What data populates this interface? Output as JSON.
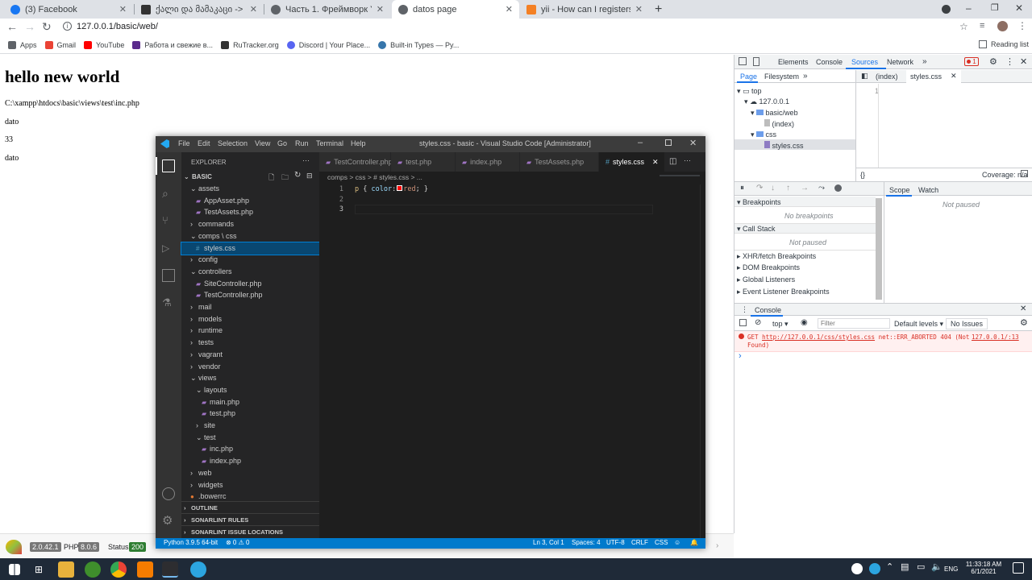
{
  "browser": {
    "tabs": [
      {
        "label": "(3) Facebook",
        "icon_color": "#1877f2",
        "active": false
      },
      {
        "label": "ქალი და მამაკაცი -> თბილი",
        "icon_color": "#333333",
        "active": false
      },
      {
        "label": "Часть 1. Фреймворк Yii2. Теори",
        "icon_color": "#5f6368",
        "active": false
      },
      {
        "label": "datos page",
        "icon_color": "#5f6368",
        "active": true
      },
      {
        "label": "yii - How can I registers jQuery a",
        "icon_color": "#f48024",
        "active": false
      }
    ],
    "new_tab": "+",
    "window_controls": {
      "minimize": "–",
      "restore": "❐",
      "close": "✕"
    },
    "url": "127.0.0.1/basic/web/",
    "bookmarks": [
      {
        "label": "Apps",
        "icon": "apps-grid-icon",
        "color": "#5f6368"
      },
      {
        "label": "Gmail",
        "icon": "gmail-icon",
        "color": "#ea4335"
      },
      {
        "label": "YouTube",
        "icon": "youtube-icon",
        "color": "#ff0000"
      },
      {
        "label": "Работа и свежие в...",
        "icon": "hh-icon",
        "color": "#5b2b8c"
      },
      {
        "label": "RuTracker.org",
        "icon": "rutracker-icon",
        "color": "#333333"
      },
      {
        "label": "Discord | Your Place...",
        "icon": "discord-icon",
        "color": "#5865f2"
      },
      {
        "label": "Built-in Types — Py...",
        "icon": "python-icon",
        "color": "#3776ab"
      }
    ],
    "reading_list": "Reading list"
  },
  "page": {
    "heading": "hello new world",
    "path": "C:\\xampp\\htdocs\\basic\\views\\test\\inc.php",
    "line1": "dato",
    "line2": "33",
    "line3": "dato"
  },
  "devtools": {
    "tabs": [
      "Elements",
      "Console",
      "Sources",
      "Network"
    ],
    "more": "»",
    "error_count": "1",
    "sources_nav": {
      "page": "Page",
      "filesystem": "Filesystem",
      "more": "»"
    },
    "tree": {
      "top": "top",
      "host": "127.0.0.1",
      "folder1": "basic/web",
      "index": "(index)",
      "folder2": "css",
      "file": "styles.css"
    },
    "editor_tabs": {
      "index": "(index)",
      "styles": "styles.css"
    },
    "line_number": "1",
    "coverage": "Coverage: n/a",
    "braces": "{}",
    "scope_tabs": {
      "scope": "Scope",
      "watch": "Watch"
    },
    "not_paused": "Not paused",
    "sections": {
      "breakpoints": "Breakpoints",
      "no_breakpoints": "No breakpoints",
      "call_stack": "Call Stack",
      "call_not_paused": "Not paused",
      "xhr": "XHR/fetch Breakpoints",
      "dom": "DOM Breakpoints",
      "global": "Global Listeners",
      "event": "Event Listener Breakpoints"
    },
    "console": {
      "title": "Console",
      "context": "top ▾",
      "filter_placeholder": "Filter",
      "levels": "Default levels ▾",
      "issues": "No Issues",
      "error_method": "GET",
      "error_url": "http://127.0.0.1/css/styles.css",
      "error_text": "net::ERR_ABORTED 404 (Not",
      "error_text2": "Found)",
      "error_source": "127.0.0.1/:13",
      "prompt": "›"
    }
  },
  "vscode": {
    "menu": [
      "File",
      "Edit",
      "Selection",
      "View",
      "Go",
      "Run",
      "Terminal",
      "Help"
    ],
    "title": "styles.css - basic - Visual Studio Code [Administrator]",
    "explorer": "EXPLORER",
    "explorer_more": "···",
    "root": "BASIC",
    "tree": [
      {
        "label": "assets",
        "depth": 1,
        "kind": "open"
      },
      {
        "label": "AppAsset.php",
        "depth": 2,
        "kind": "php"
      },
      {
        "label": "TestAssets.php",
        "depth": 2,
        "kind": "php"
      },
      {
        "label": "commands",
        "depth": 1,
        "kind": "closed"
      },
      {
        "label": "comps \\ css",
        "depth": 1,
        "kind": "open"
      },
      {
        "label": "styles.css",
        "depth": 2,
        "kind": "css",
        "selected": true
      },
      {
        "label": "config",
        "depth": 1,
        "kind": "closed"
      },
      {
        "label": "controllers",
        "depth": 1,
        "kind": "open"
      },
      {
        "label": "SiteController.php",
        "depth": 2,
        "kind": "php"
      },
      {
        "label": "TestController.php",
        "depth": 2,
        "kind": "php"
      },
      {
        "label": "mail",
        "depth": 1,
        "kind": "closed"
      },
      {
        "label": "models",
        "depth": 1,
        "kind": "closed"
      },
      {
        "label": "runtime",
        "depth": 1,
        "kind": "closed"
      },
      {
        "label": "tests",
        "depth": 1,
        "kind": "closed"
      },
      {
        "label": "vagrant",
        "depth": 1,
        "kind": "closed"
      },
      {
        "label": "vendor",
        "depth": 1,
        "kind": "closed"
      },
      {
        "label": "views",
        "depth": 1,
        "kind": "open"
      },
      {
        "label": "layouts",
        "depth": 2,
        "kind": "open"
      },
      {
        "label": "main.php",
        "depth": 3,
        "kind": "php"
      },
      {
        "label": "test.php",
        "depth": 3,
        "kind": "php"
      },
      {
        "label": "site",
        "depth": 2,
        "kind": "closed"
      },
      {
        "label": "test",
        "depth": 2,
        "kind": "open"
      },
      {
        "label": "inc.php",
        "depth": 3,
        "kind": "php"
      },
      {
        "label": "index.php",
        "depth": 3,
        "kind": "php"
      },
      {
        "label": "web",
        "depth": 1,
        "kind": "closed"
      },
      {
        "label": "widgets",
        "depth": 1,
        "kind": "closed"
      },
      {
        "label": ".bowerrc",
        "depth": 1,
        "kind": "bower"
      }
    ],
    "sidebar_sections": [
      "OUTLINE",
      "SONARLINT RULES",
      "SONARLINT ISSUE LOCATIONS"
    ],
    "editor_tabs": [
      {
        "label": "TestController.php",
        "kind": "php"
      },
      {
        "label": "test.php",
        "kind": "php"
      },
      {
        "label": "index.php",
        "kind": "php"
      },
      {
        "label": "TestAssets.php",
        "kind": "php"
      },
      {
        "label": "styles.css",
        "kind": "css",
        "active": true
      }
    ],
    "breadcrumb": "comps > css > # styles.css > ...",
    "code": {
      "line_numbers": [
        "1",
        "2",
        "3"
      ],
      "selector": "p",
      "open_brace": "{",
      "property": "color",
      "colon": ":",
      "value": "red",
      "close": ";",
      "close_brace": "}",
      "swatch_color": "#ff0000"
    },
    "status": {
      "python": "Python 3.9.5 64-bit",
      "errors": "⊗ 0 ⚠ 0",
      "position": "Ln 3, Col 1",
      "spaces": "Spaces: 4",
      "encoding": "UTF-8",
      "eol": "CRLF",
      "language": "CSS"
    }
  },
  "yii_debug": {
    "version": "2.0.42.1",
    "php_label": "PHP",
    "php_version": "8.0.6",
    "status_label": "Status",
    "status_code": "200"
  },
  "taskbar": {
    "language": "ENG",
    "time": "11:33:18 AM",
    "date": "6/1/2021"
  }
}
